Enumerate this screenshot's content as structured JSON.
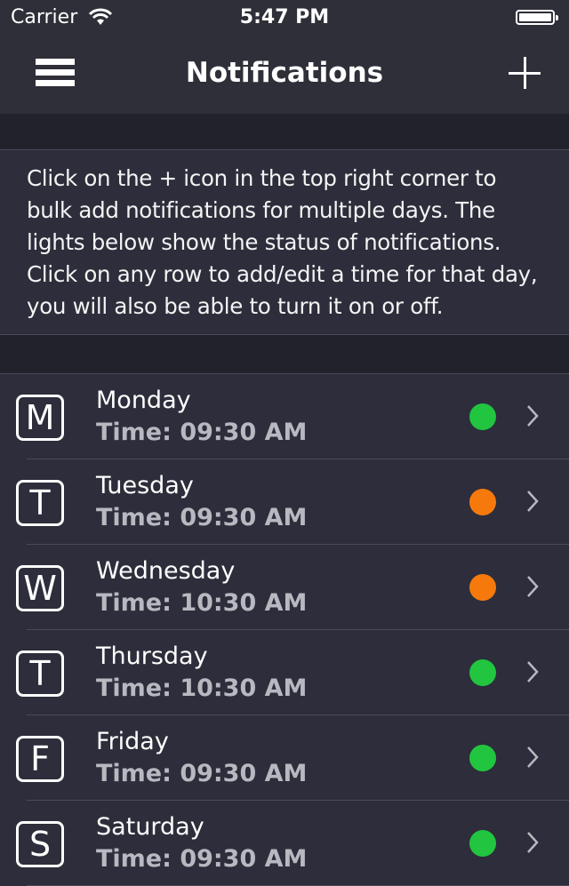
{
  "status_bar": {
    "carrier": "Carrier",
    "time": "5:47 PM",
    "battery_level": 100
  },
  "nav": {
    "title": "Notifications",
    "left_icon": "hamburger-menu-icon",
    "right_icon": "plus-icon"
  },
  "info": {
    "text": "Click on the + icon in the top right corner to bulk add notifications for multiple days. The lights below show the status of notifications. Click on any row to add/edit a time for that day, you will also be able to turn it on or off."
  },
  "colors": {
    "status_on": "#21c53f",
    "status_pending": "#f57a0b",
    "background": "#22222c",
    "row_background": "#2d2d3b",
    "nav_background": "#2e2f38"
  },
  "days": [
    {
      "letter": "M",
      "name": "Monday",
      "time": "Time: 09:30 AM",
      "status": "on"
    },
    {
      "letter": "T",
      "name": "Tuesday",
      "time": "Time: 09:30 AM",
      "status": "pending"
    },
    {
      "letter": "W",
      "name": "Wednesday",
      "time": "Time: 10:30 AM",
      "status": "pending"
    },
    {
      "letter": "T",
      "name": "Thursday",
      "time": "Time: 10:30 AM",
      "status": "on"
    },
    {
      "letter": "F",
      "name": "Friday",
      "time": "Time: 09:30 AM",
      "status": "on"
    },
    {
      "letter": "S",
      "name": "Saturday",
      "time": "Time: 09:30 AM",
      "status": "on"
    }
  ]
}
